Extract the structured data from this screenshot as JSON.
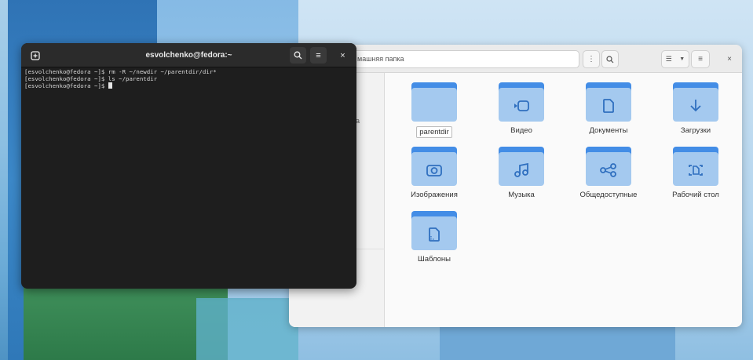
{
  "files": {
    "path": "машняя папка",
    "sidebar_fragment": "пка",
    "folders": [
      {
        "label": "parentdir",
        "icon": "folder-icon",
        "glyph": ""
      },
      {
        "label": "Видео",
        "icon": "video-folder-icon",
        "glyph": "video"
      },
      {
        "label": "Документы",
        "icon": "documents-folder-icon",
        "glyph": "document"
      },
      {
        "label": "Загрузки",
        "icon": "downloads-folder-icon",
        "glyph": "download"
      },
      {
        "label": "Изображения",
        "icon": "pictures-folder-icon",
        "glyph": "camera"
      },
      {
        "label": "Музыка",
        "icon": "music-folder-icon",
        "glyph": "music"
      },
      {
        "label": "Общедоступные",
        "icon": "public-folder-icon",
        "glyph": "share"
      },
      {
        "label": "Рабочий стол",
        "icon": "desktop-folder-icon",
        "glyph": "desktop"
      },
      {
        "label": "Шаблоны",
        "icon": "templates-folder-icon",
        "glyph": "template"
      }
    ],
    "colors": {
      "folder_tab": "#438de6",
      "folder_body": "#a4c9ef"
    }
  },
  "terminal": {
    "title": "esvolchenko@fedora:~",
    "lines": [
      "[esvolchenko@fedora ~]$ rm -R ~/newdir ~/parentdir/dir*",
      "[esvolchenko@fedora ~]$ ls ~/parentdir",
      "[esvolchenko@fedora ~]$ "
    ],
    "colors": {
      "background": "#1e1e1e",
      "header": "#2b2b2b",
      "text": "#d6d6d6"
    }
  }
}
